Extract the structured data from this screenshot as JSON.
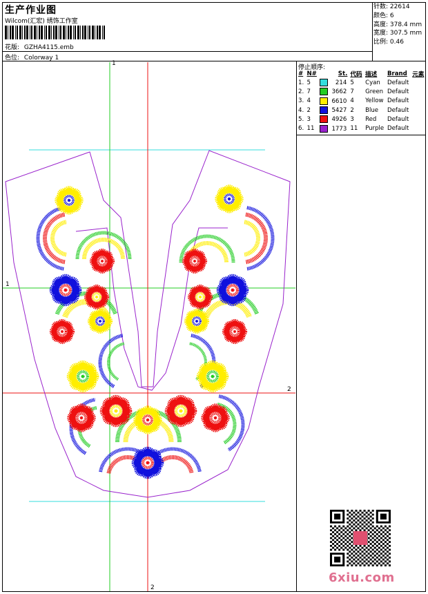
{
  "header": {
    "title": "生产作业图",
    "subtitle": "Wilcom(汇宏) 绣饰工作室",
    "design_label": "花版:",
    "design_value": "GZHA4115.emb",
    "colorway_label": "色位:",
    "colorway_value": "Colorway 1"
  },
  "stats": [
    {
      "label": "针数:",
      "value": "22614"
    },
    {
      "label": "颜色:",
      "value": "6"
    },
    {
      "label": "高度:",
      "value": "378.4 mm"
    },
    {
      "label": "宽度:",
      "value": "307.5 mm"
    },
    {
      "label": "比例:",
      "value": "0.46"
    }
  ],
  "stop_sequence": {
    "heading": "停止顺序:",
    "columns": [
      "#",
      "N#",
      "St.",
      "代码",
      "描述",
      "Brand",
      "元素"
    ],
    "rows": [
      {
        "num": "1.",
        "n": "5",
        "st": "214",
        "code": "5",
        "desc": "Cyan",
        "brand": "Default",
        "color": "#33dddd"
      },
      {
        "num": "2.",
        "n": "7",
        "st": "3662",
        "code": "7",
        "desc": "Green",
        "brand": "Default",
        "color": "#22cc22"
      },
      {
        "num": "3.",
        "n": "4",
        "st": "6610",
        "code": "4",
        "desc": "Yellow",
        "brand": "Default",
        "color": "#ffee00"
      },
      {
        "num": "4.",
        "n": "2",
        "st": "5427",
        "code": "2",
        "desc": "Blue",
        "brand": "Default",
        "color": "#1111dd"
      },
      {
        "num": "5.",
        "n": "3",
        "st": "4926",
        "code": "3",
        "desc": "Red",
        "brand": "Default",
        "color": "#ee1111"
      },
      {
        "num": "6.",
        "n": "11",
        "st": "1773",
        "code": "11",
        "desc": "Purple",
        "brand": "Default",
        "color": "#9922cc"
      }
    ]
  },
  "guides": {
    "v1_label": "1",
    "h1_label": "1",
    "h2_label": "2",
    "v2_label": "2"
  },
  "watermark": "6xiu.com",
  "colors": {
    "cyan": "#33dddd",
    "green": "#22cc22",
    "yellow": "#ffee00",
    "blue": "#1111dd",
    "red": "#ee1111",
    "purple": "#9922cc"
  }
}
